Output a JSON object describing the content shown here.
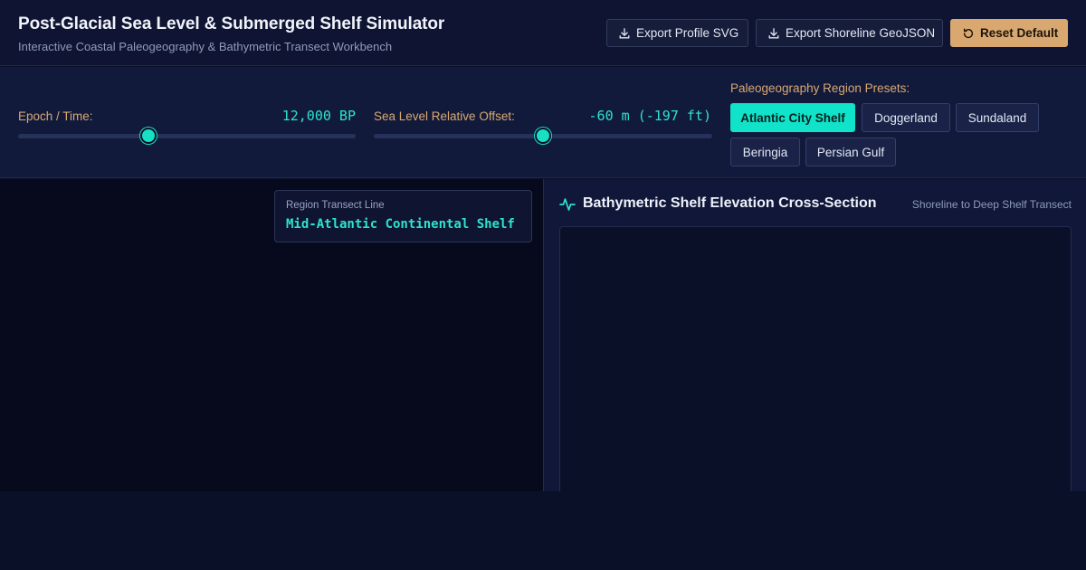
{
  "header": {
    "title": "Post-Glacial Sea Level & Submerged Shelf Simulator",
    "subtitle": "Interactive Coastal Paleogeography & Bathymetric Transect Workbench",
    "buttons": {
      "export_svg": "Export Profile SVG",
      "export_geojson": "Export Shoreline GeoJSON",
      "reset": "Reset Default"
    }
  },
  "controls": {
    "epoch": {
      "label": "Epoch / Time:",
      "value": "12,000 BP"
    },
    "sea_level": {
      "label": "Sea Level Relative Offset:",
      "value": "-60 m (-197 ft)"
    },
    "presets_label": "Paleogeography Region Presets:",
    "presets": [
      {
        "label": "Atlantic City Shelf",
        "active": true
      },
      {
        "label": "Doggerland",
        "active": false
      },
      {
        "label": "Sundaland",
        "active": false
      },
      {
        "label": "Beringia",
        "active": false
      },
      {
        "label": "Persian Gulf",
        "active": false
      }
    ]
  },
  "map": {
    "transect_caption": "Region Transect Line",
    "transect_name": "Mid-Atlantic Continental Shelf"
  },
  "profile": {
    "title": "Bathymetric Shelf Elevation Cross-Section",
    "subtitle": "Shoreline to Deep Shelf Transect"
  },
  "colors": {
    "accent_teal": "#10e3c9",
    "accent_amber": "#d9a871",
    "background": "#0b1029"
  }
}
